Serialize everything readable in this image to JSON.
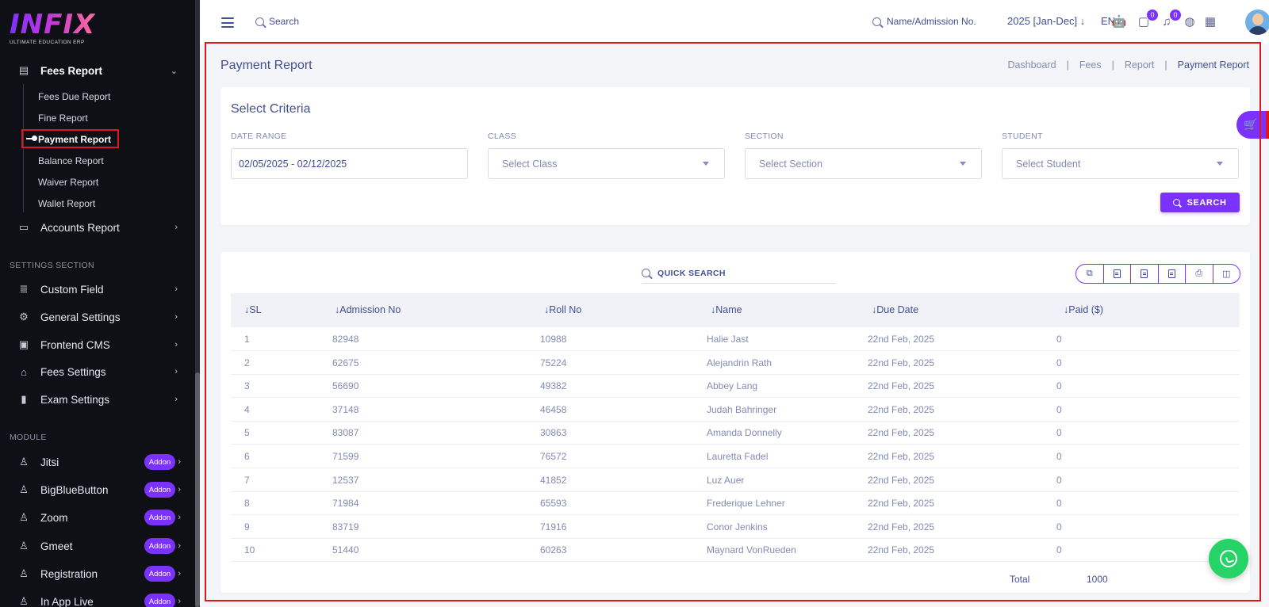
{
  "brand": {
    "logo_text": "INFIX",
    "tagline": "ULTIMATE EDUCATION ERP"
  },
  "sidebar": {
    "fees_report": {
      "label": "Fees Report",
      "icon": "table-icon"
    },
    "sub_items": [
      {
        "label": "Fees Due Report",
        "active": false
      },
      {
        "label": "Fine Report",
        "active": false
      },
      {
        "label": "Payment Report",
        "active": true
      },
      {
        "label": "Balance Report",
        "active": false
      },
      {
        "label": "Waiver Report",
        "active": false
      },
      {
        "label": "Wallet Report",
        "active": false
      }
    ],
    "accounts_report": {
      "label": "Accounts Report"
    },
    "settings_section_title": "SETTINGS SECTION",
    "settings_items": [
      {
        "label": "Custom Field"
      },
      {
        "label": "General Settings"
      },
      {
        "label": "Frontend CMS"
      },
      {
        "label": "Fees Settings"
      },
      {
        "label": "Exam Settings"
      }
    ],
    "module_section_title": "MODULE",
    "module_items": [
      {
        "label": "Jitsi",
        "badge": "Addon"
      },
      {
        "label": "BigBlueButton",
        "badge": "Addon"
      },
      {
        "label": "Zoom",
        "badge": "Addon"
      },
      {
        "label": "Gmeet",
        "badge": "Addon"
      },
      {
        "label": "Registration",
        "badge": "Addon"
      },
      {
        "label": "In App Live",
        "badge": "Addon"
      }
    ]
  },
  "topbar": {
    "search_label": "Search",
    "name_search_label": "Name/Admission No.",
    "academic_year": "2025 [Jan-Dec]",
    "language": "EN",
    "chat_count": "0",
    "notification_count": "0"
  },
  "page": {
    "title": "Payment Report",
    "breadcrumb": [
      "Dashboard",
      "Fees",
      "Report",
      "Payment Report"
    ]
  },
  "criteria": {
    "heading": "Select Criteria",
    "date_range_label": "DATE RANGE",
    "date_range_value": "02/05/2025 - 02/12/2025",
    "class_label": "CLASS",
    "class_placeholder": "Select Class",
    "section_label": "SECTION",
    "section_placeholder": "Select Section",
    "student_label": "STUDENT",
    "student_placeholder": "Select Student",
    "search_button": "SEARCH"
  },
  "table": {
    "quick_search_label": "QUICK SEARCH",
    "export_buttons": [
      "copy-icon",
      "excel-icon",
      "csv-icon",
      "pdf-icon",
      "print-icon",
      "columns-icon"
    ],
    "columns": [
      "SL",
      "Admission No",
      "Roll No",
      "Name",
      "Due Date",
      "Paid ($)"
    ],
    "rows": [
      {
        "sl": "1",
        "admission_no": "82948",
        "roll_no": "10988",
        "name": "Halie Jast",
        "due_date": "22nd Feb, 2025",
        "paid": "0"
      },
      {
        "sl": "2",
        "admission_no": "62675",
        "roll_no": "75224",
        "name": "Alejandrin Rath",
        "due_date": "22nd Feb, 2025",
        "paid": "0"
      },
      {
        "sl": "3",
        "admission_no": "56690",
        "roll_no": "49382",
        "name": "Abbey Lang",
        "due_date": "22nd Feb, 2025",
        "paid": "0"
      },
      {
        "sl": "4",
        "admission_no": "37148",
        "roll_no": "46458",
        "name": "Judah Bahringer",
        "due_date": "22nd Feb, 2025",
        "paid": "0"
      },
      {
        "sl": "5",
        "admission_no": "83087",
        "roll_no": "30863",
        "name": "Amanda Donnelly",
        "due_date": "22nd Feb, 2025",
        "paid": "0"
      },
      {
        "sl": "6",
        "admission_no": "71599",
        "roll_no": "76572",
        "name": "Lauretta Fadel",
        "due_date": "22nd Feb, 2025",
        "paid": "0"
      },
      {
        "sl": "7",
        "admission_no": "12537",
        "roll_no": "41852",
        "name": "Luz Auer",
        "due_date": "22nd Feb, 2025",
        "paid": "0"
      },
      {
        "sl": "8",
        "admission_no": "71984",
        "roll_no": "65593",
        "name": "Frederique Lehner",
        "due_date": "22nd Feb, 2025",
        "paid": "0"
      },
      {
        "sl": "9",
        "admission_no": "83719",
        "roll_no": "71916",
        "name": "Conor Jenkins",
        "due_date": "22nd Feb, 2025",
        "paid": "0"
      },
      {
        "sl": "10",
        "admission_no": "51440",
        "roll_no": "60263",
        "name": "Maynard VonRueden",
        "due_date": "22nd Feb, 2025",
        "paid": "0"
      }
    ],
    "total_label": "Total",
    "total_value": "1000"
  },
  "colors": {
    "accent": "#7c32ff",
    "highlight": "#e0161c",
    "whatsapp": "#25d366",
    "sidebar_bg": "#0f1016"
  }
}
